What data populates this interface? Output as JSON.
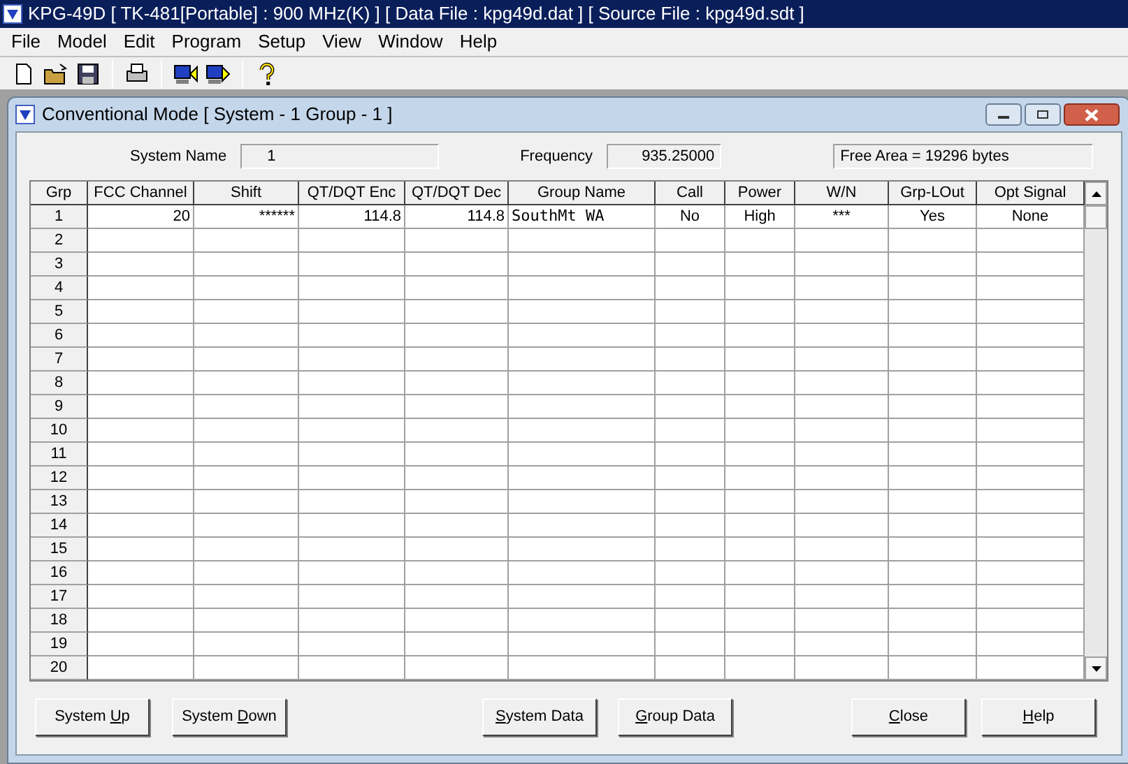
{
  "window": {
    "title": "KPG-49D  [ TK-481[Portable] : 900 MHz(K) ] [ Data File : kpg49d.dat ] [ Source File : kpg49d.sdt ]"
  },
  "menu": [
    "File",
    "Model",
    "Edit",
    "Program",
    "Setup",
    "View",
    "Window",
    "Help"
  ],
  "toolbar": [
    {
      "kind": "new"
    },
    {
      "kind": "open"
    },
    {
      "kind": "save"
    },
    {
      "kind": "sep"
    },
    {
      "kind": "print"
    },
    {
      "kind": "sep"
    },
    {
      "kind": "read"
    },
    {
      "kind": "write"
    },
    {
      "kind": "sep"
    },
    {
      "kind": "help"
    }
  ],
  "child": {
    "title": "Conventional Mode [ System - 1  Group - 1 ]",
    "system_name": {
      "label": "System Name",
      "value": "1"
    },
    "frequency": {
      "label": "Frequency",
      "value": "935.25000"
    },
    "free_area": "Free Area = 19296 bytes",
    "table": {
      "columns": [
        "Grp",
        "FCC Channel",
        "Shift",
        "QT/DQT Enc",
        "QT/DQT Dec",
        "Group Name",
        "Call",
        "Power",
        "W/N",
        "Grp-LOut",
        "Opt Signal"
      ],
      "rows": [
        [
          "1",
          "20",
          "******",
          "114.8",
          "114.8",
          "SouthMt WA",
          "No",
          "High",
          "***",
          "Yes",
          "None"
        ],
        [
          "2"
        ],
        [
          "3"
        ],
        [
          "4"
        ],
        [
          "5"
        ],
        [
          "6"
        ],
        [
          "7"
        ],
        [
          "8"
        ],
        [
          "9"
        ],
        [
          "10"
        ],
        [
          "11"
        ],
        [
          "12"
        ],
        [
          "13"
        ],
        [
          "14"
        ],
        [
          "15"
        ],
        [
          "16"
        ],
        [
          "17"
        ],
        [
          "18"
        ],
        [
          "19"
        ],
        [
          "20"
        ]
      ]
    },
    "buttons": [
      {
        "before": "System ",
        "key": "U",
        "after": "p"
      },
      {
        "before": "System ",
        "key": "D",
        "after": "own"
      },
      {
        "key": "S",
        "after": "ystem Data"
      },
      {
        "key": "G",
        "after": "roup Data"
      },
      {
        "key": "C",
        "after": "lose"
      },
      {
        "key": "H",
        "after": "elp"
      }
    ]
  }
}
